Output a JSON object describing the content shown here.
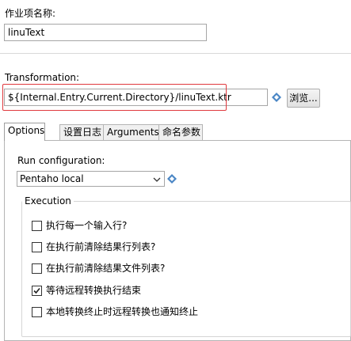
{
  "job_name": {
    "label": "作业项名称:",
    "value": "linuText"
  },
  "transformation": {
    "label": "Transformation:",
    "value": "${Internal.Entry.Current.Directory}/linuText.ktr",
    "browse_label": "浏览..."
  },
  "tabs": [
    {
      "label": "Options",
      "active": true
    },
    {
      "label": "设置日志",
      "active": false
    },
    {
      "label": "Arguments",
      "active": false
    },
    {
      "label": "命名参数",
      "active": false
    }
  ],
  "options": {
    "run_config_label": "Run configuration:",
    "run_config_value": "Pentaho local",
    "execution_title": "Execution",
    "checkboxes": [
      {
        "label": "执行每一个输入行?",
        "checked": false
      },
      {
        "label": "在执行前清除结果行列表?",
        "checked": false
      },
      {
        "label": "在执行前清除结果文件列表?",
        "checked": false
      },
      {
        "label": "等待远程转换执行结束",
        "checked": true
      },
      {
        "label": "本地转换终止时远程转换也通知终止",
        "checked": false
      }
    ]
  },
  "colors": {
    "highlight_border": "#e0393e",
    "variable_icon": "#4a86c5"
  },
  "icons": {
    "variable": "diamond-variable-icon",
    "dropdown": "chevron-down-icon",
    "check": "checkmark-icon"
  }
}
